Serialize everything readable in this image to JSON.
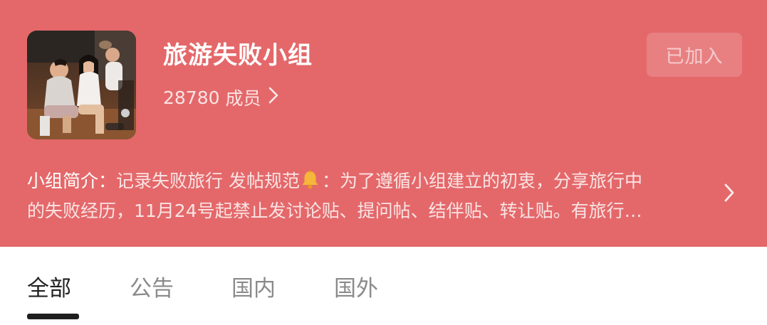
{
  "group": {
    "name": "旅游失败小组",
    "member_count": "28780",
    "member_label": "成员",
    "join_status": "已加入"
  },
  "intro": {
    "label": "小组简介：",
    "line1_text": "记录失败旅行 发帖规范",
    "line1_after_icon": "：为了遵循小组建立的初衷，分享旅行中",
    "line2": "的失败经历，11月24号起禁止发讨论贴、提问帖、结伴贴、转让贴。有旅行…"
  },
  "tabs": [
    {
      "label": "全部",
      "active": true
    },
    {
      "label": "公告",
      "active": false
    },
    {
      "label": "国内",
      "active": false
    },
    {
      "label": "国外",
      "active": false
    }
  ],
  "colors": {
    "header_bg": "#e4686a",
    "active_tab": "#222222",
    "inactive_tab": "#8a8a8a"
  },
  "icons": [
    "chevron-right-icon",
    "bell-icon"
  ]
}
